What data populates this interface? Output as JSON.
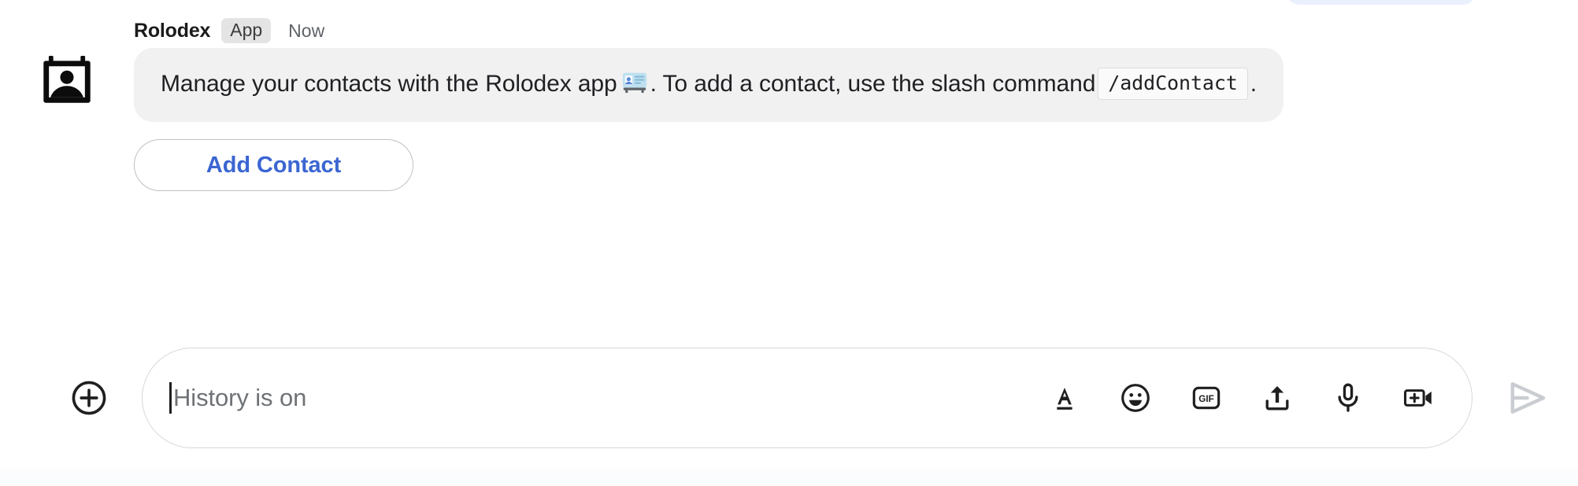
{
  "message": {
    "avatar_icon": "contact-card-icon",
    "sender": "Rolodex",
    "badge": "App",
    "timestamp": "Now",
    "text_part1": "Manage your contacts with the Rolodex app",
    "emoji": "card-index-emoji",
    "text_part2": ". To add a contact, use the slash command",
    "code_chip": "/addContact",
    "text_part3": ".",
    "action_button": "Add Contact"
  },
  "composer": {
    "add_label": "plus-circle-icon",
    "placeholder": "History is on",
    "value": "",
    "tools": [
      {
        "name": "format-text-icon",
        "label": "A"
      },
      {
        "name": "emoji-icon",
        "label": ""
      },
      {
        "name": "gif-icon",
        "label": "GIF"
      },
      {
        "name": "upload-icon",
        "label": ""
      },
      {
        "name": "microphone-icon",
        "label": ""
      },
      {
        "name": "video-add-icon",
        "label": ""
      }
    ],
    "send_label": "send-icon"
  },
  "colors": {
    "accent_link": "#3b66d2",
    "bubble_bg": "#f1f1f1",
    "badge_bg": "#e3e4e3",
    "placeholder_text": "#6f7276",
    "send_disabled": "#c9ccd1",
    "prev_bubble": "#eaf0fd"
  }
}
